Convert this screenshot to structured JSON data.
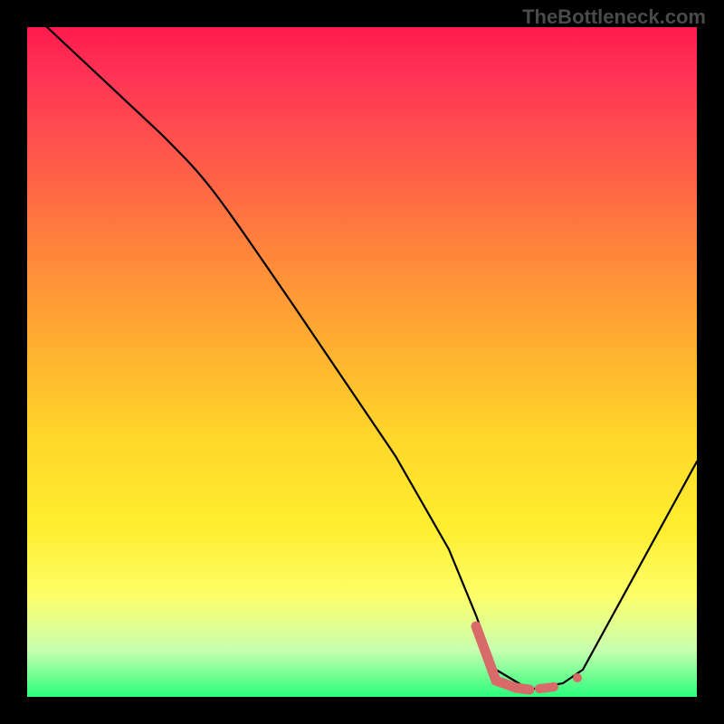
{
  "watermark": "TheBottleneck.com",
  "chart_data": {
    "type": "line",
    "title": "",
    "xlabel": "",
    "ylabel": "",
    "xlim": [
      0,
      100
    ],
    "ylim": [
      0,
      100
    ],
    "series": [
      {
        "name": "main-curve",
        "color": "#000000",
        "x": [
          3,
          20,
          27,
          40,
          55,
          63,
          67,
          70,
          75,
          80,
          83,
          100
        ],
        "values": [
          100,
          84,
          77,
          58,
          36,
          22,
          12,
          4,
          1,
          2,
          4,
          35
        ]
      },
      {
        "name": "highlight-segment",
        "color": "#d96a6a",
        "x": [
          67,
          70,
          73,
          75,
          77,
          80,
          82.5
        ],
        "values": [
          10,
          3,
          1,
          1,
          1,
          2,
          4
        ]
      }
    ],
    "gradient_stops": [
      {
        "pos": 0,
        "color": "#ff1a4d"
      },
      {
        "pos": 20,
        "color": "#ff5a4a"
      },
      {
        "pos": 48,
        "color": "#ffb030"
      },
      {
        "pos": 75,
        "color": "#ffee30"
      },
      {
        "pos": 93,
        "color": "#c8ffb0"
      },
      {
        "pos": 100,
        "color": "#2aff7a"
      }
    ]
  }
}
